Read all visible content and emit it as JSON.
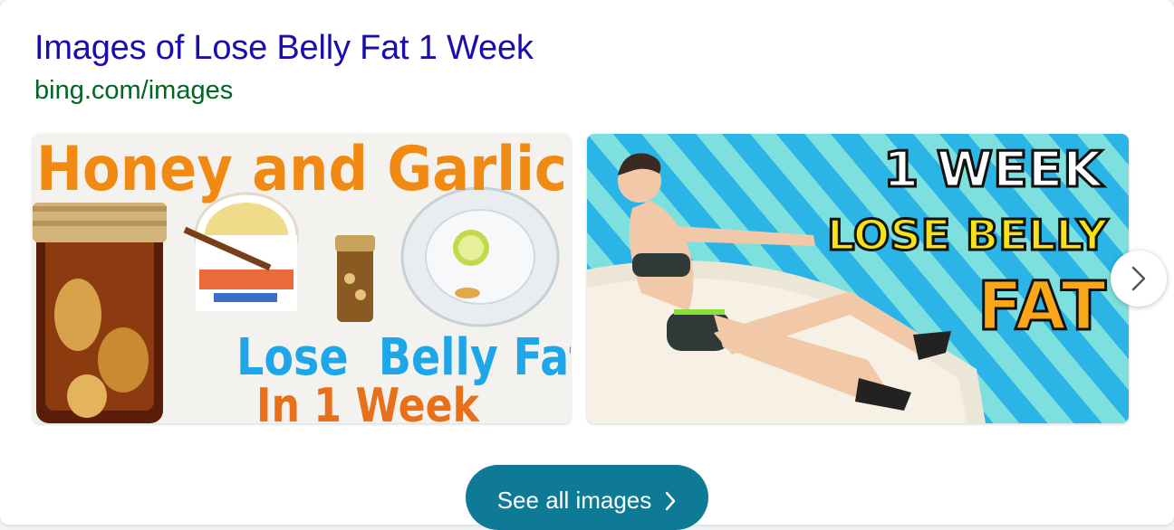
{
  "result": {
    "title": "Images of Lose Belly Fat 1 Week",
    "source": "bing.com/images"
  },
  "images": [
    {
      "lines": [
        "Honey and Garlic",
        "Lose  Belly Fat",
        "In 1 Week"
      ]
    },
    {
      "lines": [
        "1 WEEK",
        "LOSE BELLY",
        "FAT"
      ]
    }
  ],
  "controls": {
    "see_all_label": "See all images",
    "next_icon": "chevron-right-icon",
    "see_all_icon": "chevron-right-icon"
  },
  "colors": {
    "title": "#1a0dab",
    "source": "#006621",
    "button": "#0f7a95"
  }
}
